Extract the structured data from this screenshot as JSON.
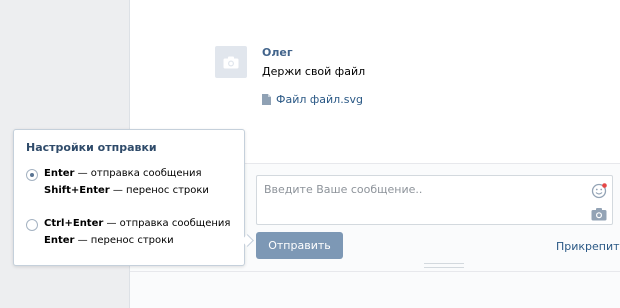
{
  "message": {
    "author": "Олег",
    "text": "Держи свой файл",
    "attachment": "Файл файл.svg"
  },
  "composer": {
    "placeholder": "Введите Ваше сообщение..",
    "send_label": "Отправить",
    "attach_label": "Прикрепить"
  },
  "send_settings": {
    "title": "Настройки отправки",
    "options": [
      {
        "selected": true,
        "line1_key": "Enter",
        "line1_rest": " — отправка сообщения",
        "line2_key": "Shift+Enter",
        "line2_rest": " — перенос строки"
      },
      {
        "selected": false,
        "line1_key": "Ctrl+Enter",
        "line1_rest": " — отправка сообщения",
        "line2_key": "Enter",
        "line2_rest": " — перенос строки"
      }
    ]
  },
  "colors": {
    "accent": "#7d98b5",
    "link": "#2a5885",
    "author": "#42648b",
    "notification_dot": "#e64646"
  },
  "icons": {
    "avatar": "camera-icon",
    "attachment": "file-icon",
    "emoji": "smile-icon",
    "photo": "camera-icon"
  }
}
